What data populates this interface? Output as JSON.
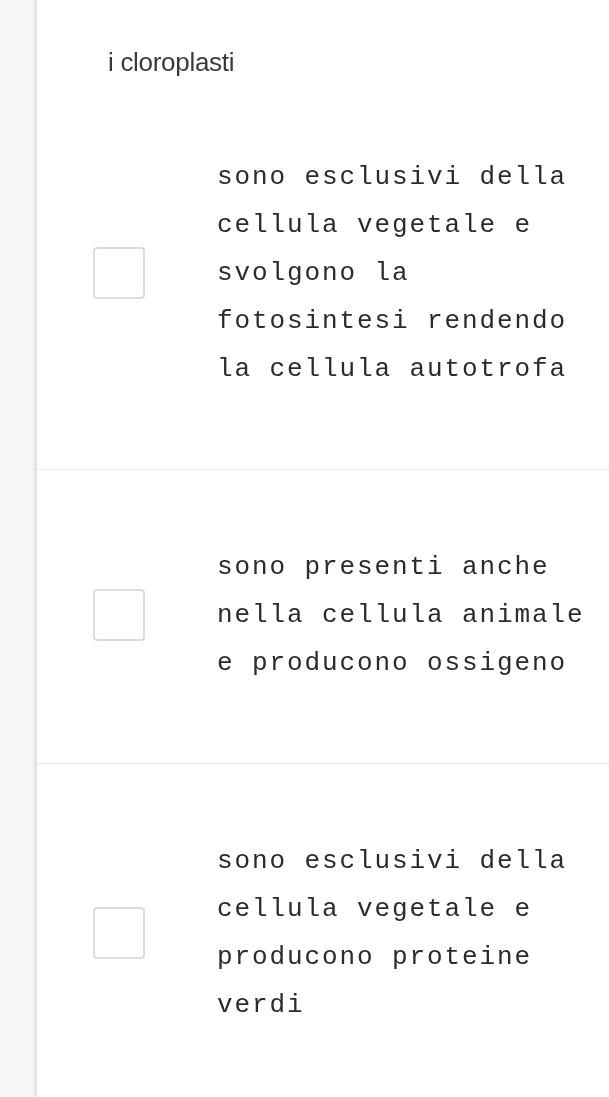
{
  "question": {
    "title": "i cloroplasti"
  },
  "options": [
    {
      "text": "sono esclusivi della cellula vegetale e svolgono la fotosintesi rendendo la cellula autotrofa",
      "checked": false
    },
    {
      "text": "sono presenti anche nella cellula animale e producono ossigeno",
      "checked": false
    },
    {
      "text": "sono esclusivi della cellula vegetale e producono proteine verdi",
      "checked": false
    }
  ]
}
